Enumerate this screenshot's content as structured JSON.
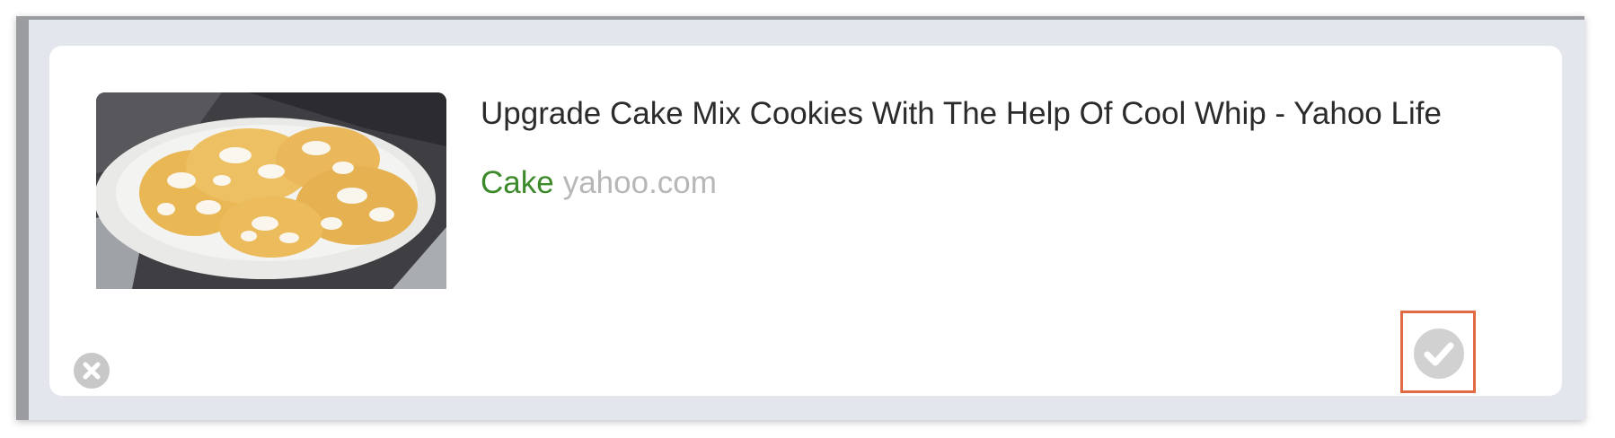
{
  "card": {
    "title": "Upgrade Cake Mix Cookies With The Help Of Cool Whip - Yahoo Life",
    "tag": "Cake",
    "domain": "yahoo.com",
    "image_alt": "Crinkle cookies on a white plate"
  },
  "icons": {
    "close": "close-icon",
    "check": "check-icon"
  },
  "colors": {
    "tag": "#3c8a2b",
    "domain": "#b7b7b7",
    "highlight": "#e06a43",
    "panel": "#e3e6ec"
  }
}
